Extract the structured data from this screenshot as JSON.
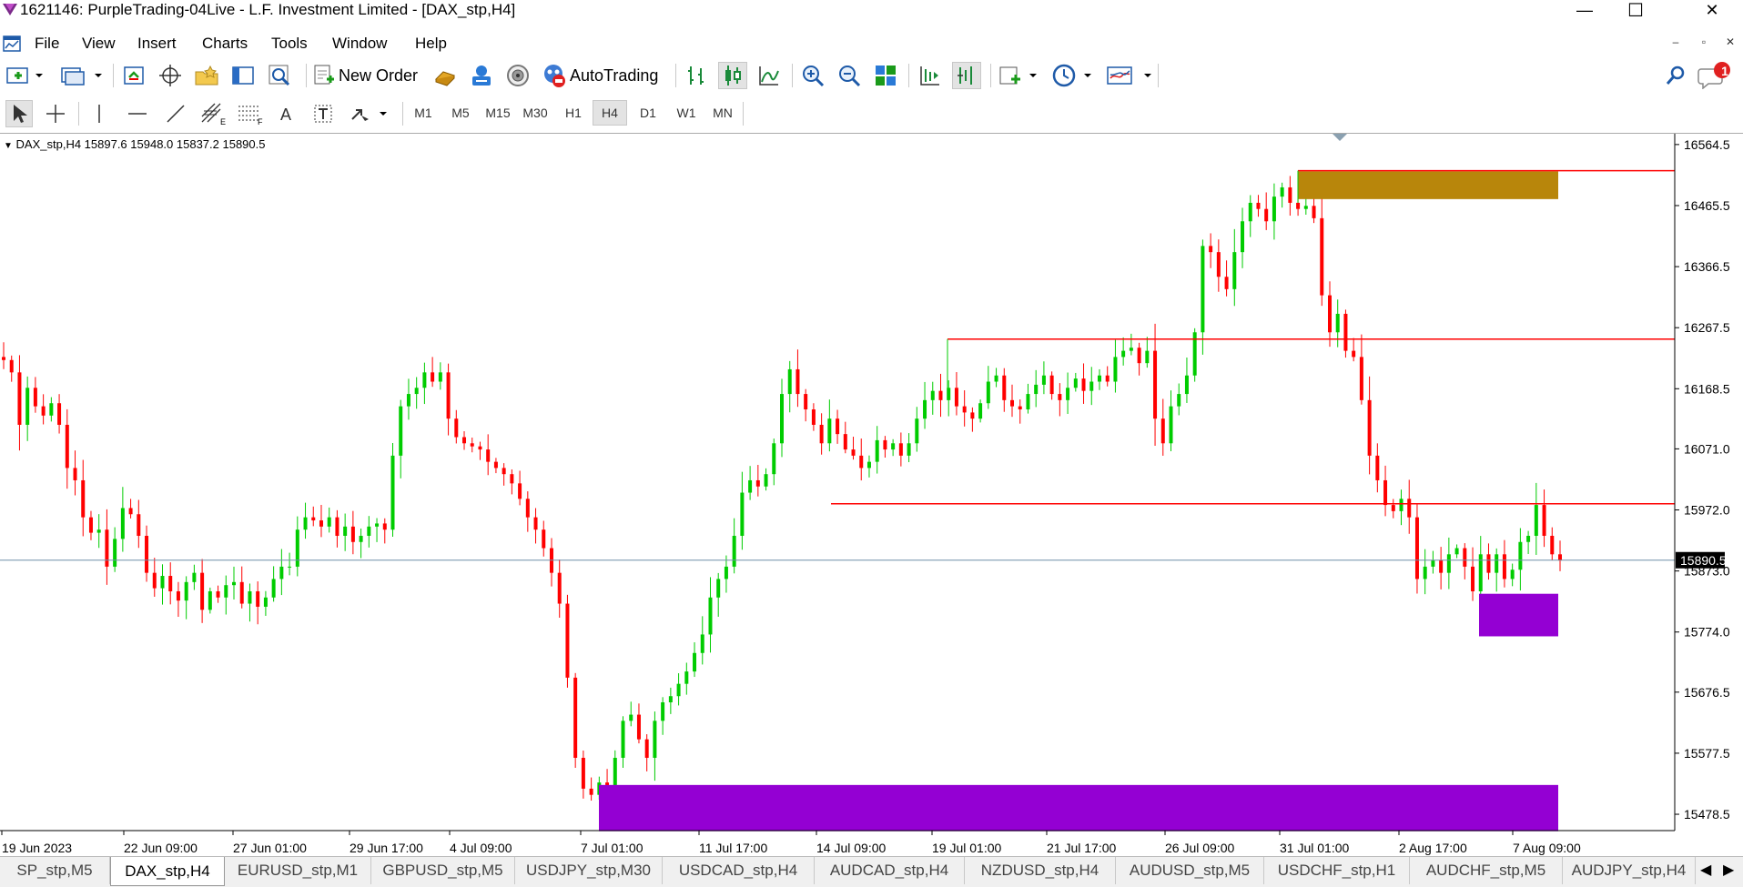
{
  "window": {
    "title": "1621146: PurpleTrading-04Live - L.F. Investment Limited - [DAX_stp,H4]",
    "minimize": "—",
    "maximize": "☐",
    "close": "✕"
  },
  "menu": {
    "items": [
      "File",
      "View",
      "Insert",
      "Charts",
      "Tools",
      "Window",
      "Help"
    ],
    "mdi_min": "–",
    "mdi_restore": "▫",
    "mdi_close": "✕"
  },
  "toolbar": {
    "new_order": "New Order",
    "autotrading": "AutoTrading",
    "notification_count": "1"
  },
  "timeframes": {
    "items": [
      "M1",
      "M5",
      "M15",
      "M30",
      "H1",
      "H4",
      "D1",
      "W1",
      "MN"
    ],
    "active": "H4"
  },
  "chart_info": "DAX_stp,H4  15897.6 15948.0 15837.2 15890.5",
  "chart_data": {
    "type": "candlestick",
    "symbol": "DAX_stp",
    "timeframe": "H4",
    "ohlc_header": {
      "open": 15897.6,
      "high": 15948.0,
      "low": 15837.2,
      "close": 15890.5
    },
    "current_price": "15890.5",
    "y_ticks": [
      "16564.5",
      "16465.5",
      "16366.5",
      "16267.5",
      "16168.5",
      "16071.0",
      "15972.0",
      "15873.0",
      "15774.0",
      "15676.5",
      "15577.5",
      "15478.5"
    ],
    "x_ticks": [
      "19 Jun 2023",
      "22 Jun 09:00",
      "27 Jun 01:00",
      "29 Jun 17:00",
      "4 Jul 09:00",
      "7 Jul 01:00",
      "11 Jul 17:00",
      "14 Jul 09:00",
      "19 Jul 01:00",
      "21 Jul 17:00",
      "26 Jul 09:00",
      "31 Jul 01:00",
      "2 Aug 17:00",
      "7 Aug 09:00"
    ],
    "ylim": [
      15452,
      16582
    ],
    "bull_color": "#00cc00",
    "bear_color": "#ff0000",
    "hlines": [
      16522,
      16249,
      15982
    ],
    "zones": [
      {
        "top": 16521,
        "bottom": 16476,
        "color": "#b8860b"
      },
      {
        "top": 15836,
        "bottom": 15767,
        "color": "#9400d3"
      },
      {
        "top": 15526,
        "bottom": 15451,
        "color": "#9400d3"
      }
    ],
    "path": [
      16220,
      16215,
      16195,
      16110,
      16170,
      16140,
      16125,
      16145,
      16110,
      16040,
      16020,
      15960,
      15935,
      15940,
      15880,
      15925,
      15975,
      15965,
      15930,
      15870,
      15845,
      15865,
      15840,
      15825,
      15855,
      15870,
      15810,
      15840,
      15830,
      15850,
      15855,
      15820,
      15840,
      15815,
      15830,
      15860,
      15880,
      15880,
      15940,
      15960,
      15955,
      15945,
      15960,
      15930,
      15945,
      15920,
      15930,
      15945,
      15950,
      15940,
      16060,
      16140,
      16160,
      16170,
      16195,
      16180,
      16195,
      16120,
      16090,
      16080,
      16075,
      16070,
      16050,
      16040,
      16030,
      16015,
      15990,
      15960,
      15940,
      15910,
      15870,
      15820,
      15700,
      15570,
      15520,
      15510,
      15530,
      15510,
      15570,
      15630,
      15640,
      15600,
      15570,
      15630,
      15660,
      15670,
      15690,
      15710,
      15740,
      15770,
      15830,
      15860,
      15880,
      15930,
      16000,
      16020,
      16010,
      16030,
      16080,
      16160,
      16200,
      16160,
      16135,
      16110,
      16080,
      16120,
      16095,
      16070,
      16060,
      16040,
      16050,
      16085,
      16070,
      16080,
      16060,
      16080,
      16120,
      16150,
      16165,
      16150,
      16170,
      16140,
      16130,
      16120,
      16145,
      16180,
      16190,
      16150,
      16140,
      16135,
      16160,
      16175,
      16190,
      16160,
      16150,
      16170,
      16185,
      16165,
      16180,
      16190,
      16180,
      16220,
      16230,
      16235,
      16210,
      16230,
      16120,
      16080,
      16140,
      16160,
      16190,
      16260,
      16400,
      16390,
      16350,
      16330,
      16390,
      16440,
      16470,
      16460,
      16440,
      16480,
      16495,
      16470,
      16460,
      16465,
      16445,
      16320,
      16260,
      16290,
      16230,
      16220,
      16150,
      16060,
      16020,
      15980,
      15970,
      15990,
      15960,
      15860,
      15880,
      15890,
      15870,
      15900,
      15910,
      15880,
      15840,
      15900,
      15870,
      15900,
      15860,
      15875,
      15920,
      15930,
      15980,
      15930,
      15900,
      15890
    ]
  },
  "tabs": {
    "items": [
      "SP_stp,M5",
      "DAX_stp,H4",
      "EURUSD_stp,M1",
      "GBPUSD_stp,M5",
      "USDJPY_stp,M30",
      "USDCAD_stp,H4",
      "AUDCAD_stp,H4",
      "NZDUSD_stp,H4",
      "AUDUSD_stp,M5",
      "USDCHF_stp,H1",
      "AUDCHF_stp,M5",
      "AUDJPY_stp,H4"
    ],
    "active": "DAX_stp,H4",
    "prev": "◀",
    "next": "▶"
  }
}
